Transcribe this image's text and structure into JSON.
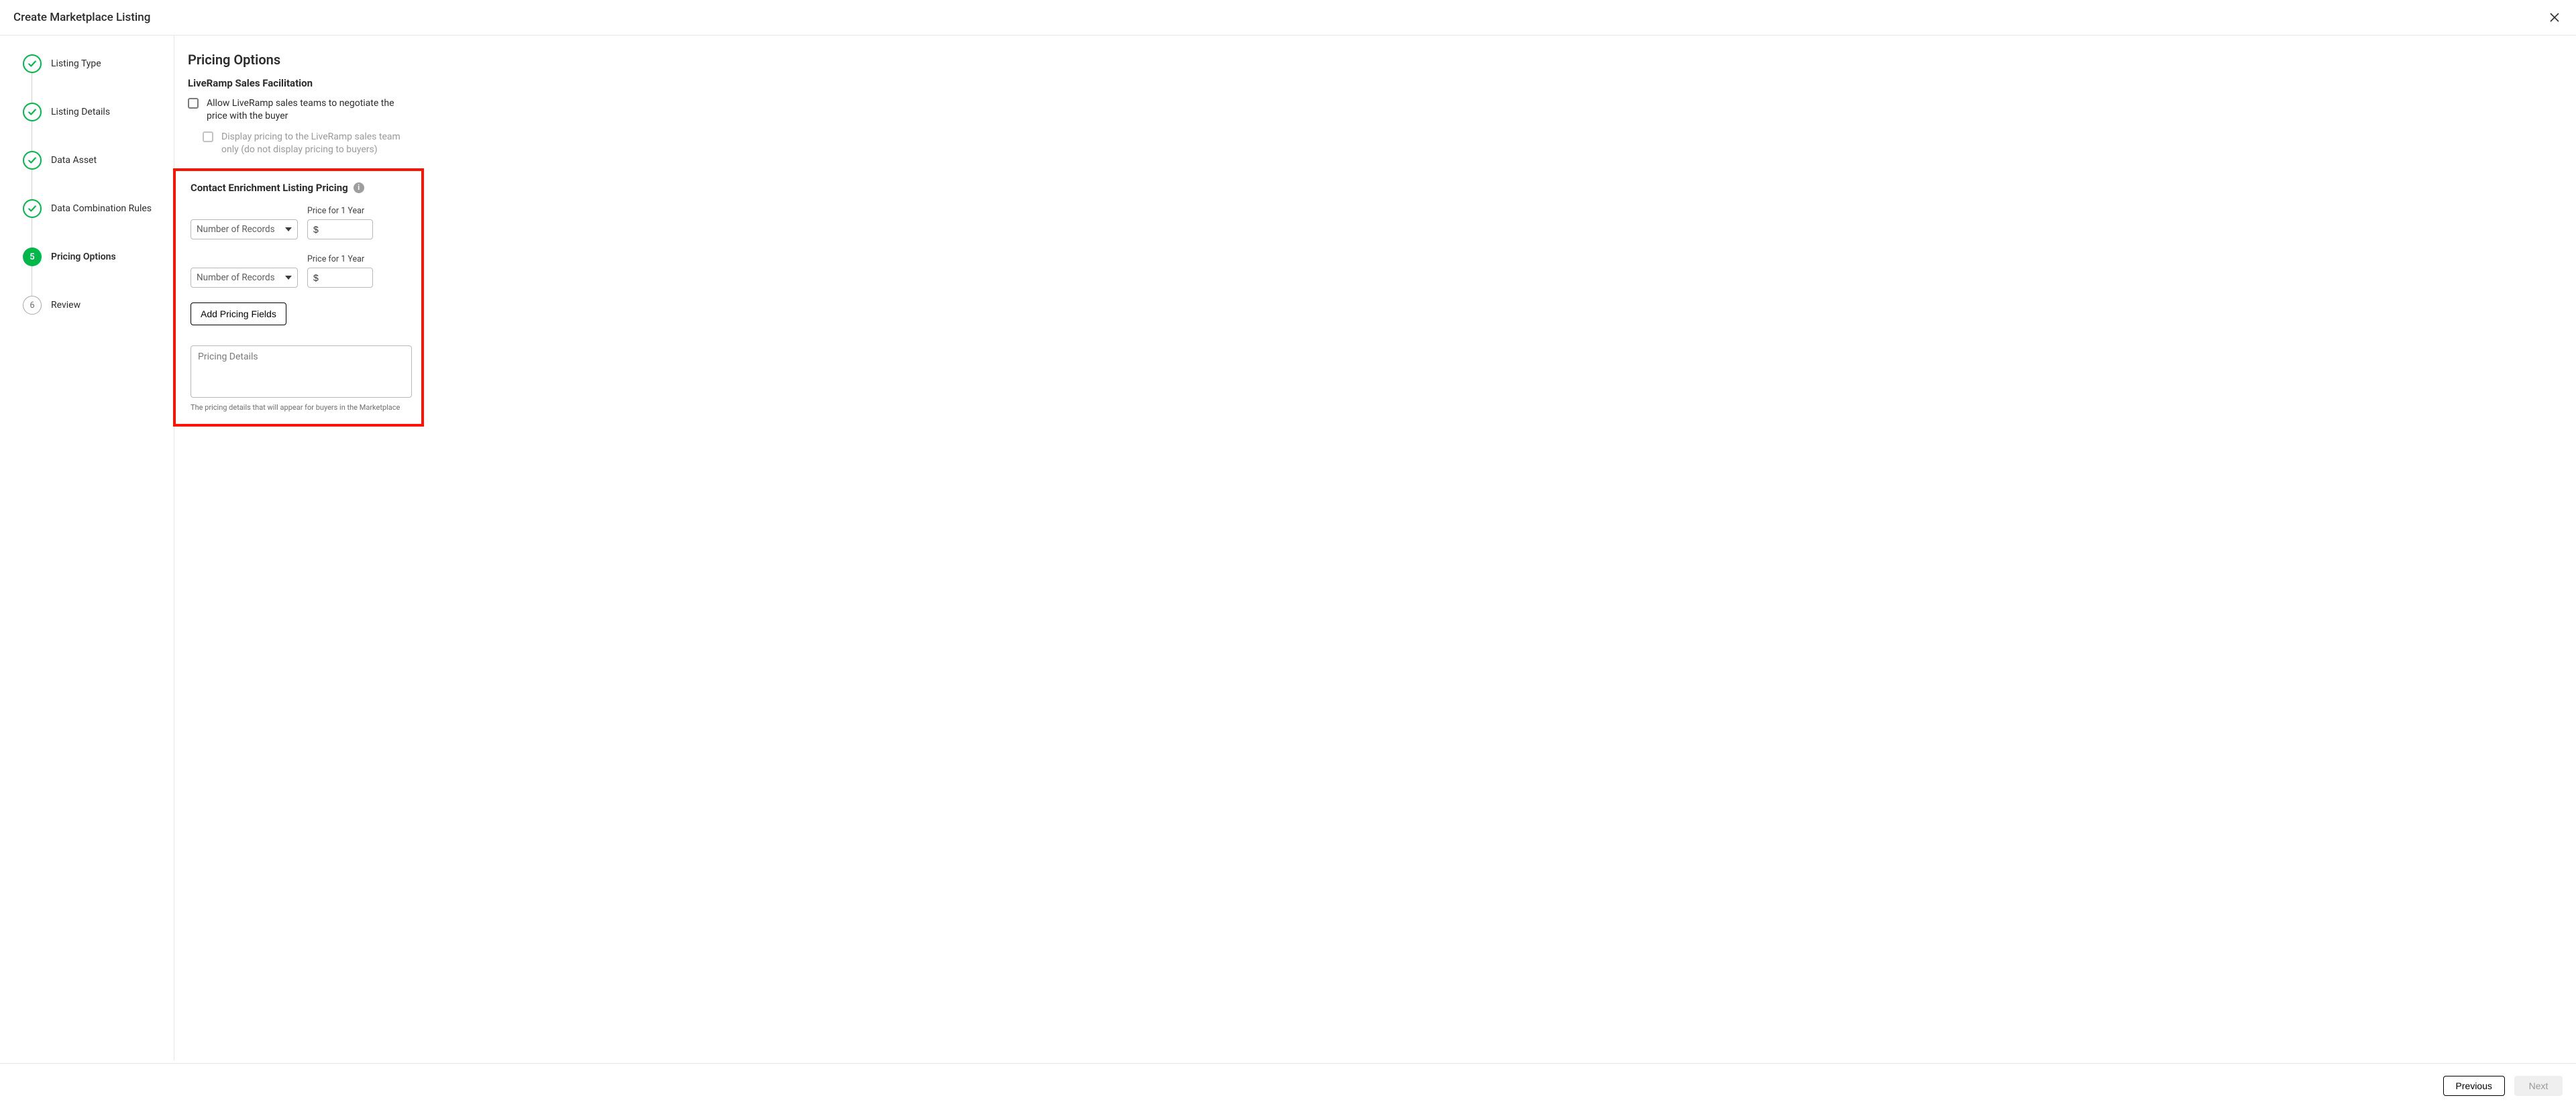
{
  "header": {
    "title": "Create Marketplace Listing"
  },
  "steps": [
    {
      "label": "Listing Type",
      "state": "done"
    },
    {
      "label": "Listing Details",
      "state": "done"
    },
    {
      "label": "Data Asset",
      "state": "done"
    },
    {
      "label": "Data Combination Rules",
      "state": "done"
    },
    {
      "label": "Pricing Options",
      "state": "current",
      "number": "5"
    },
    {
      "label": "Review",
      "state": "upcoming",
      "number": "6"
    }
  ],
  "content": {
    "section_title": "Pricing Options",
    "sales": {
      "title": "LiveRamp Sales Facilitation",
      "allow_label": "Allow LiveRamp sales teams to negotiate the price with the buyer",
      "display_label": "Display pricing to the LiveRamp sales team only (do not display pricing to buyers)"
    },
    "enrichment": {
      "title": "Contact Enrichment Listing Pricing",
      "rows": [
        {
          "records_placeholder": "Number of Records",
          "price_label": "Price for 1 Year",
          "price_value": "$"
        },
        {
          "records_placeholder": "Number of Records",
          "price_label": "Price for 1 Year",
          "price_value": "$"
        }
      ],
      "add_button": "Add Pricing Fields",
      "details_placeholder": "Pricing Details",
      "details_helper": "The pricing details that will appear for buyers in the Marketplace"
    }
  },
  "footer": {
    "prev": "Previous",
    "next": "Next"
  }
}
